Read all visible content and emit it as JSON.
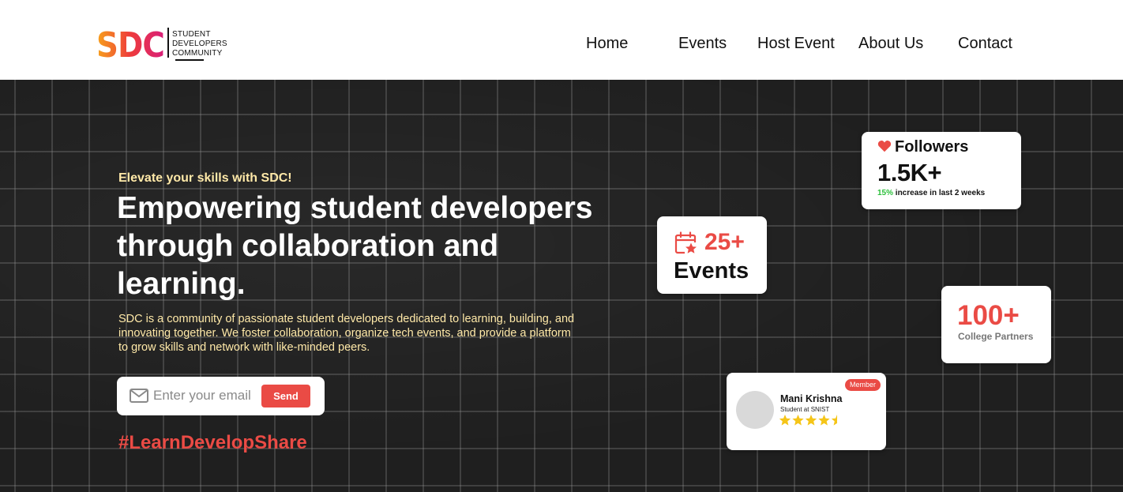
{
  "header": {
    "logo": {
      "letters": "SDC",
      "tagline": [
        "STUDENT",
        "DEVELOPERS",
        "COMMUNITY"
      ]
    },
    "nav": [
      "Home",
      "Events",
      "Host Event",
      "About Us",
      "Contact"
    ]
  },
  "hero": {
    "eyebrow": "Elevate your skills with SDC!",
    "headline": "Empowering student developers through collaboration and learning.",
    "description": "SDC is a community of passionate student developers dedicated to learning, building, and innovating together. We foster collaboration, organize tech events, and provide a platform to grow skills and network with like-minded peers.",
    "email": {
      "placeholder": "Enter your email",
      "icon": "mail-icon",
      "button": "Send"
    },
    "hashtag": "#LearnDevelopShare"
  },
  "stats": {
    "followers": {
      "icon": "heart-icon",
      "title": "Followers",
      "count": "1.5K+",
      "increase": "15%",
      "note": "increase in last 2 weeks"
    },
    "events": {
      "icon": "calendar-star-icon",
      "count": "25+",
      "label": "Events"
    },
    "partners": {
      "count": "100+",
      "label": "College Partners"
    }
  },
  "member": {
    "badge": "Member",
    "name": "Mani Krishna",
    "role": "Student at SNIST",
    "rating": 4.5,
    "rating_max": 5
  },
  "colors": {
    "accent": "#ea4b45",
    "cream": "#ffe9a8",
    "background": "#1f1f1f",
    "star": "#f5c518",
    "success": "#2bbf3a"
  }
}
